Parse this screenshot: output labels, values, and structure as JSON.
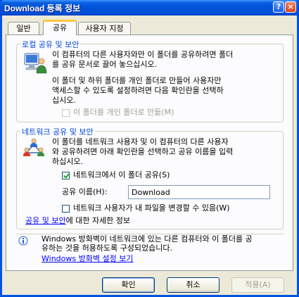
{
  "window": {
    "title": "Download 등록 정보",
    "help_btn": "?",
    "close_btn": "×"
  },
  "tabs": [
    {
      "label": "일반"
    },
    {
      "label": "공유"
    },
    {
      "label": "사용자 지정"
    }
  ],
  "local": {
    "title": "로컬 공유 및 보안",
    "desc1_l1": "이 컴퓨터의 다른 사용자와만 이 폴더를 공유하려면 폴더",
    "desc1_l2": "를 공유 문서로 끌어 놓으십시오.",
    "desc2_l1": "이 폴더 및 하위 폴더를 개인 폴더로 만들어 사용자만",
    "desc2_l2": "액세스할 수 있도록 설정하려면 다음 확인란을 선택하",
    "desc2_l3": "십시오.",
    "private_label": "이 폴더를 개인 폴더로 만듦(M)",
    "private_checked": false
  },
  "network": {
    "title": "네트워크 공유 및 보안",
    "desc_l1": "이 폴더를 네트워크 사용자 및 이 컴퓨터의 다른 사용자",
    "desc_l2": "와 공유하려면 아래 확인란을 선택하고 공유 이름을 입력",
    "desc_l3": "하십시오.",
    "share_label": "네트워크에서 이 폴더 공유(S)",
    "share_checked": true,
    "share_name_label": "공유 이름(H):",
    "share_name_value": "Download",
    "allow_change_label": "네트워크 사용자가 내 파일을 변경할 수 있음(W)",
    "allow_change_checked": false,
    "more_link": "공유 및 보안",
    "more_suffix": "에 대한 자세한 정보"
  },
  "firewall": {
    "info_l1": "Windows 방화벽이 네트워크에 있는 다른 컴퓨터와 이 폴더를 공",
    "info_l2": "유하는 것을 허용하도록 구성되었습니다.",
    "settings_link": "Windows 방화벽 설정 보기"
  },
  "buttons": {
    "ok": "확인",
    "cancel": "취소",
    "apply": "적용(A)"
  }
}
